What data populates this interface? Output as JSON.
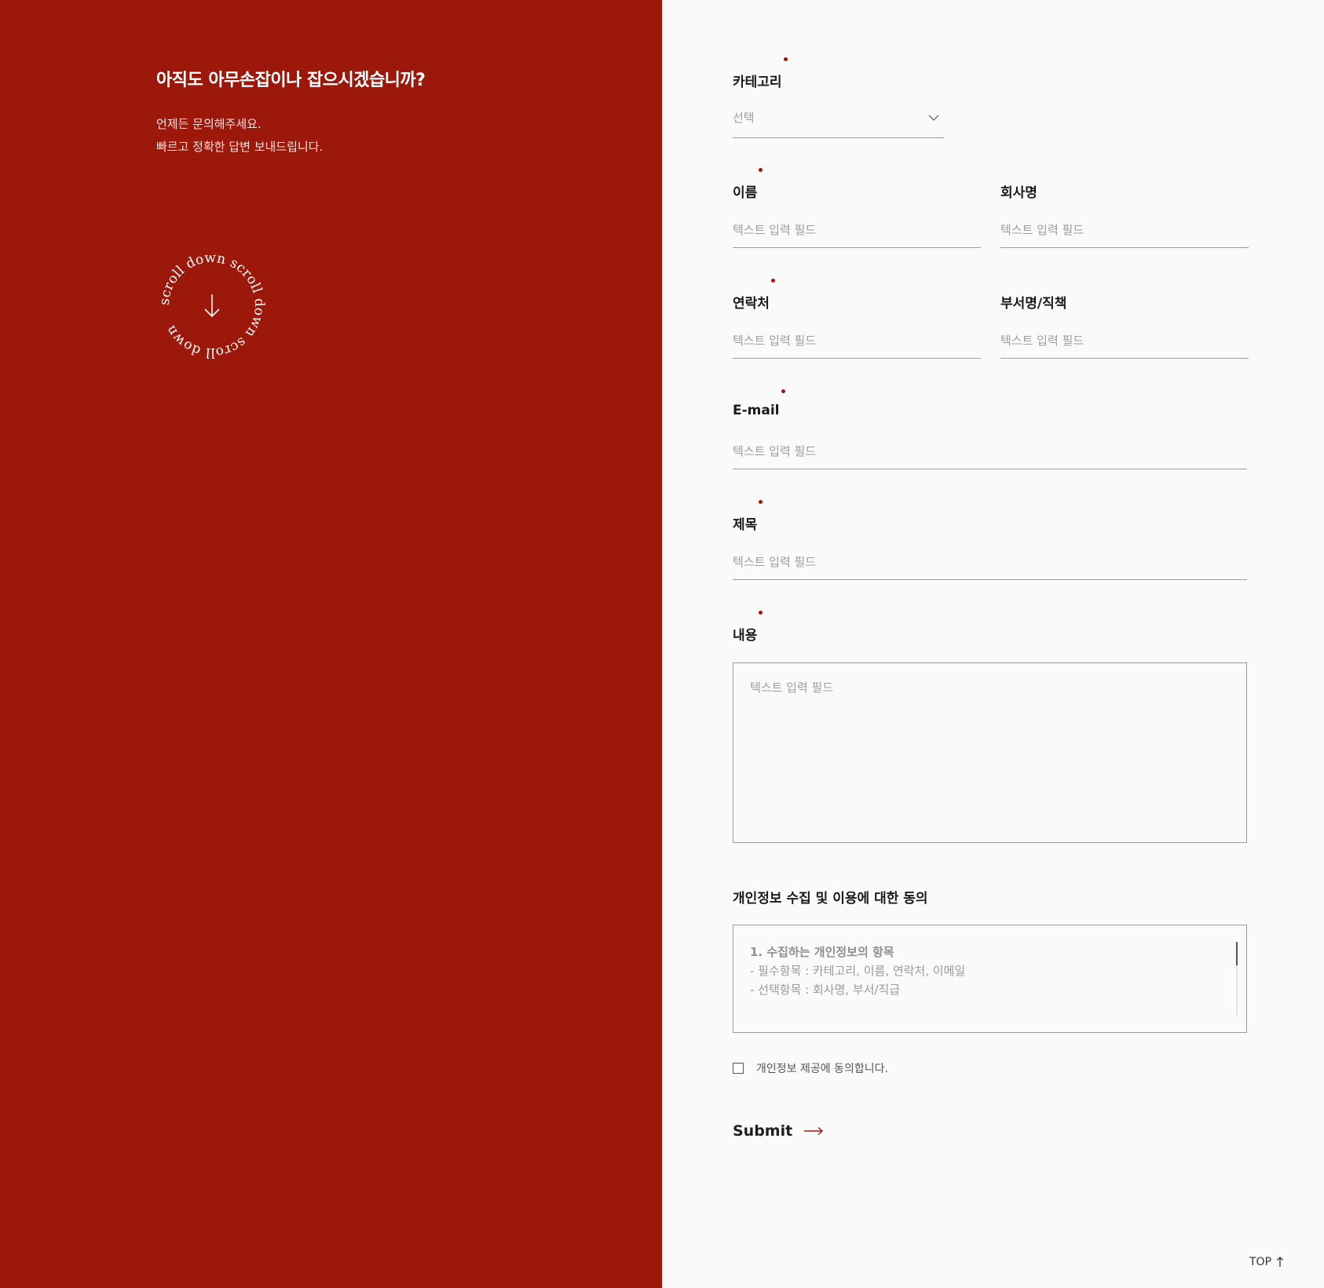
{
  "left": {
    "headline": "아직도 아무손잡이나 잡으시겠습니까?",
    "desc_line1": "언제든 문의해주세요.",
    "desc_line2": "빠르고 정확한 답변 보내드립니다.",
    "scroll_badge_text": "scroll down scroll down scroll down"
  },
  "form": {
    "category": {
      "label": "카테고리",
      "value": "선택"
    },
    "name": {
      "label": "이름",
      "placeholder": "텍스트 입력 필드"
    },
    "company": {
      "label": "회사명",
      "placeholder": "텍스트 입력 필드"
    },
    "phone": {
      "label": "연락처",
      "placeholder": "텍스트 입력 필드"
    },
    "department": {
      "label": "부서명/직책",
      "placeholder": "텍스트 입력 필드"
    },
    "email": {
      "label": "E-mail",
      "placeholder": "텍스트 입력 필드"
    },
    "subject": {
      "label": "제목",
      "placeholder": "텍스트 입력 필드"
    },
    "content": {
      "label": "내용",
      "placeholder": "텍스트 입력 필드"
    }
  },
  "privacy": {
    "title": "개인정보 수집 및 이용에 대한 동의",
    "heading": "1. 수집하는 개인정보의 항목",
    "line1": "- 필수항목 : 카테고리, 이름, 연락처, 이메일",
    "line2": "- 선택항목 : 회사명, 부서/직급",
    "agree_label": "개인정보 제공에 동의합니다."
  },
  "submit_label": "Submit",
  "top_label": "TOP",
  "colors": {
    "brand_red": "#9c180b",
    "background": "#fafafa"
  }
}
